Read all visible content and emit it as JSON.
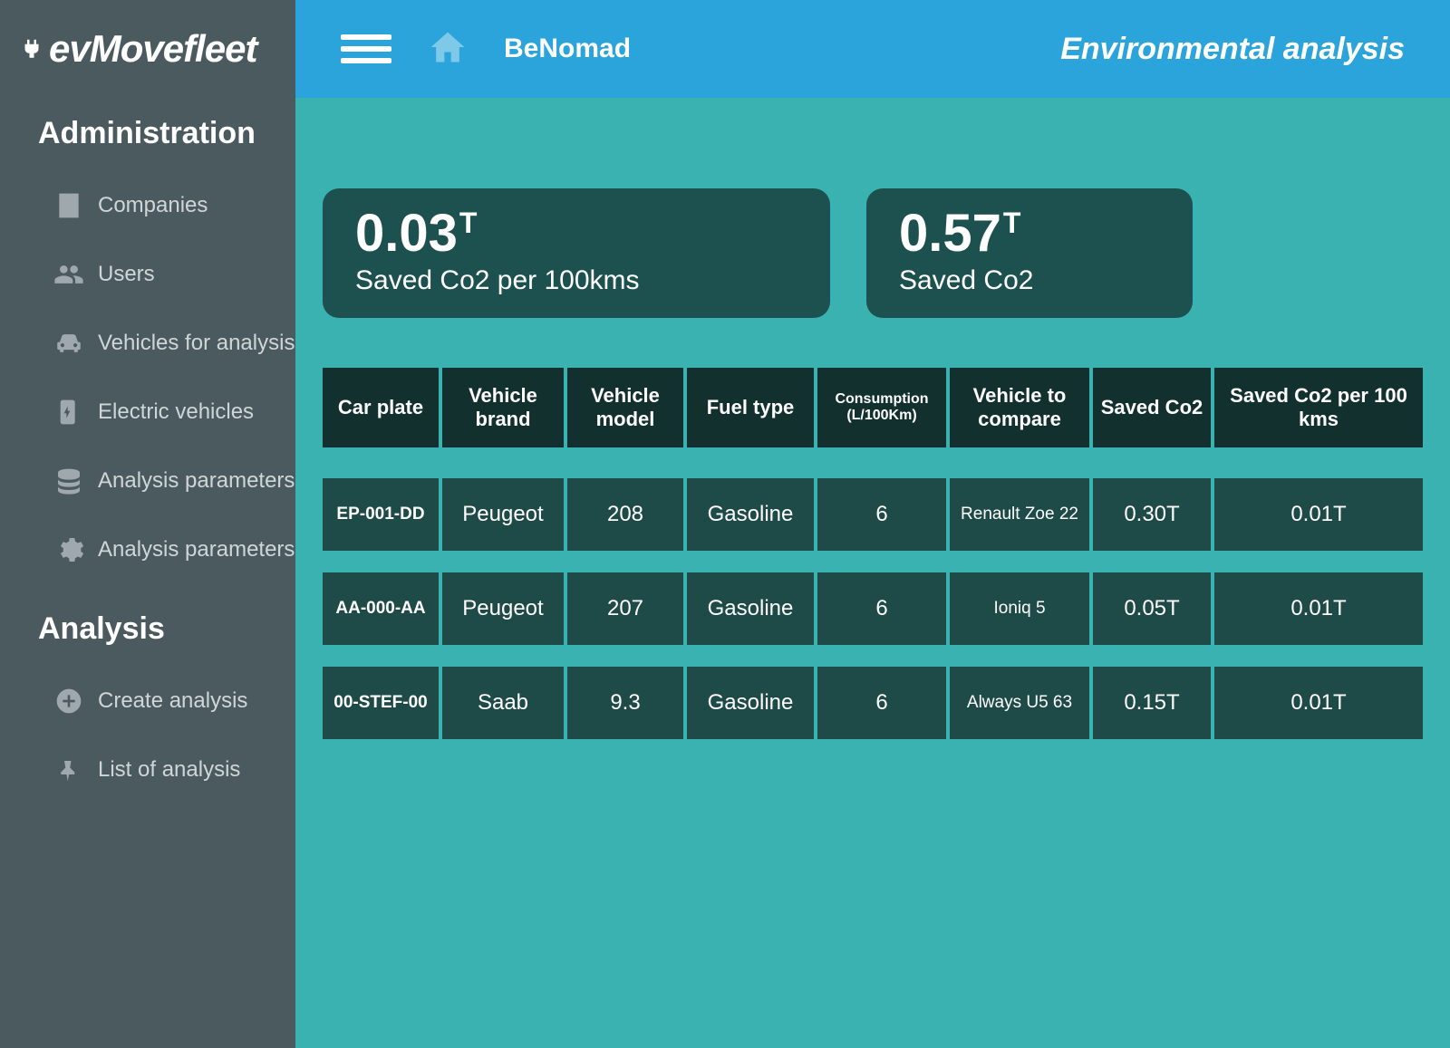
{
  "app": {
    "name": "evMovefleet"
  },
  "header": {
    "breadcrumb": "BeNomad",
    "page_title": "Environmental analysis"
  },
  "sidebar": {
    "section1_title": "Administration",
    "section2_title": "Analysis",
    "admin_items": [
      {
        "label": "Companies",
        "icon": "building"
      },
      {
        "label": "Users",
        "icon": "users"
      },
      {
        "label": "Vehicles for analysis",
        "icon": "car"
      },
      {
        "label": "Electric vehicles",
        "icon": "charger"
      },
      {
        "label": "Analysis parameters",
        "icon": "database"
      },
      {
        "label": "Analysis parameters",
        "icon": "gears"
      }
    ],
    "analysis_items": [
      {
        "label": "Create analysis",
        "icon": "plus"
      },
      {
        "label": "List of analysis",
        "icon": "pin"
      }
    ]
  },
  "kpis": [
    {
      "value": "0.03",
      "unit": "T",
      "label": "Saved Co2 per 100kms"
    },
    {
      "value": "0.57",
      "unit": "T",
      "label": "Saved Co2"
    }
  ],
  "table": {
    "headers": [
      "Car plate",
      "Vehicle brand",
      "Vehicle model",
      "Fuel type",
      "Consumption (L/100Km)",
      "Vehicle to compare",
      "Saved Co2",
      "Saved Co2 per 100 kms"
    ],
    "rows": [
      {
        "plate": "EP-001-DD",
        "brand": "Peugeot",
        "model": "208",
        "fuel": "Gasoline",
        "cons": "6",
        "compare": "Renault Zoe 22",
        "saved": "0.30T",
        "saved100": "0.01T"
      },
      {
        "plate": "AA-000-AA",
        "brand": "Peugeot",
        "model": "207",
        "fuel": "Gasoline",
        "cons": "6",
        "compare": "Ioniq 5",
        "saved": "0.05T",
        "saved100": "0.01T"
      },
      {
        "plate": "00-STEF-00",
        "brand": "Saab",
        "model": "9.3",
        "fuel": "Gasoline",
        "cons": "6",
        "compare": "Always U5 63",
        "saved": "0.15T",
        "saved100": "0.01T"
      }
    ]
  }
}
